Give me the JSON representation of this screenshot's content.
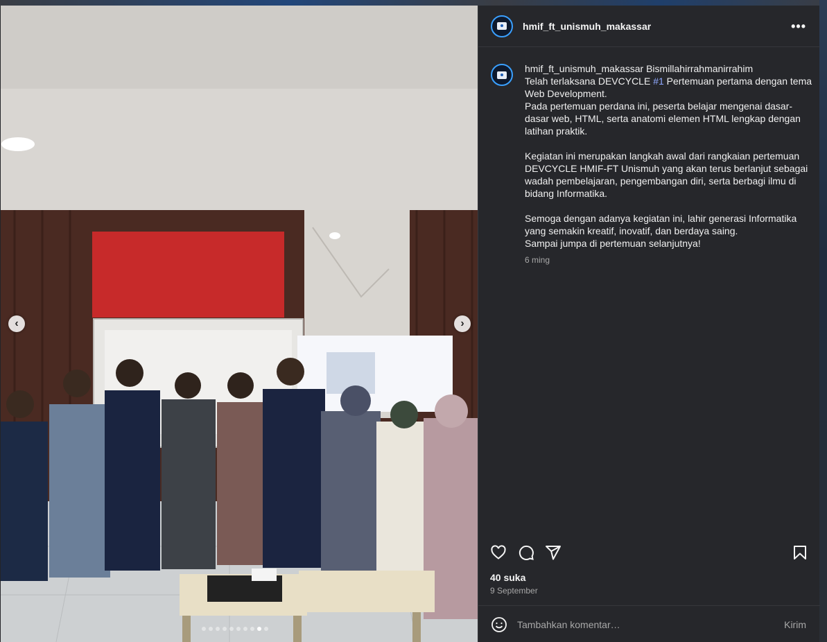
{
  "post": {
    "username": "hmif_ft_unismuh_makassar",
    "more_icon": "more-horizontal-icon",
    "caption": {
      "username": "hmif_ft_unismuh_makassar",
      "first_line": " Bismillahirrahmanirrahim",
      "line2_before": "Telah terlaksana DEVCYCLE ",
      "hashtag": "#1",
      "line2_after": " Pertemuan pertama dengan tema Web Development.",
      "para1": "Pada pertemuan perdana ini, peserta belajar mengenai dasar-dasar web, HTML, serta anatomi elemen HTML lengkap dengan latihan praktik.",
      "para2": "Kegiatan ini merupakan langkah awal dari rangkaian pertemuan DEVCYCLE HMIF-FT Unismuh yang akan terus berlanjut sebagai wadah pembelajaran, pengembangan diri, serta berbagi ilmu di bidang Informatika.",
      "para3a": "Semoga dengan adanya kegiatan ini, lahir generasi Informatika yang semakin kreatif, inovatif, dan berdaya saing.",
      "para3b": "Sampai jumpa di pertemuan selanjutnya!",
      "time": "6 ming"
    },
    "likes": "40 suka",
    "date": "9 September",
    "comment": {
      "placeholder": "Tambahkan komentar…",
      "value": "",
      "send_label": "Kirim"
    },
    "carousel": {
      "total": 10,
      "active_index": 8
    }
  },
  "icons": {
    "like": "heart-icon",
    "comment": "comment-icon",
    "share": "send-icon",
    "save": "bookmark-icon",
    "emoji": "emoji-icon",
    "prev": "chevron-left-icon",
    "next": "chevron-right-icon"
  },
  "colors": {
    "panel": "#26272b",
    "hashtag": "#8fa8ff",
    "muted": "#a8a8a8"
  }
}
